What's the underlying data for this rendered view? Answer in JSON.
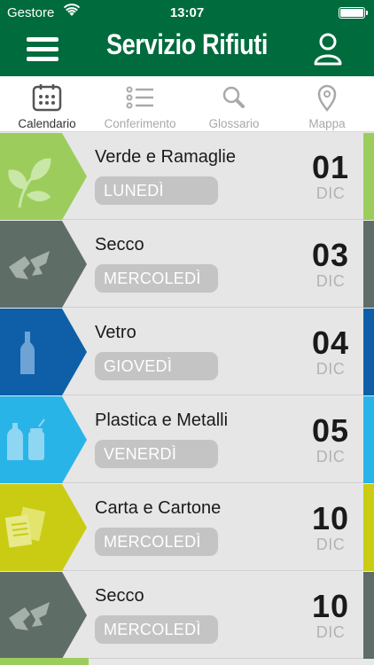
{
  "status_bar": {
    "carrier": "Gestore",
    "time": "13:07"
  },
  "header": {
    "title": "Servizio Rifiuti"
  },
  "tabs": [
    {
      "label": "Calendario",
      "icon": "calendar-icon",
      "active": true
    },
    {
      "label": "Conferimento",
      "icon": "list-icon",
      "active": false
    },
    {
      "label": "Glossario",
      "icon": "search-icon",
      "active": false
    },
    {
      "label": "Mappa",
      "icon": "map-pin-icon",
      "active": false
    }
  ],
  "colors": {
    "brand_green": "#006b3d",
    "verde": "#9ccd5c",
    "secco": "#5f6d67",
    "vetro": "#0f5fa8",
    "plastica": "#29b4e8",
    "carta": "#c9cc12"
  },
  "collections": [
    {
      "name": "Verde e Ramaglie",
      "day": "LUNEDÌ",
      "date": "01",
      "month": "DIC",
      "icon": "leaves-icon",
      "color": "#9ccd5c"
    },
    {
      "name": "Secco",
      "day": "MERCOLEDÌ",
      "date": "03",
      "month": "DIC",
      "icon": "broken-dish-icon",
      "color": "#5f6d67"
    },
    {
      "name": "Vetro",
      "day": "GIOVEDÌ",
      "date": "04",
      "month": "DIC",
      "icon": "bottle-icon",
      "color": "#0f5fa8"
    },
    {
      "name": "Plastica e Metalli",
      "day": "VENERDÌ",
      "date": "05",
      "month": "DIC",
      "icon": "bottle-can-icon",
      "color": "#29b4e8"
    },
    {
      "name": "Carta e Cartone",
      "day": "MERCOLEDÌ",
      "date": "10",
      "month": "DIC",
      "icon": "paper-icon",
      "color": "#c9cc12"
    },
    {
      "name": "Secco",
      "day": "MERCOLEDÌ",
      "date": "10",
      "month": "DIC",
      "icon": "broken-dish-icon",
      "color": "#5f6d67"
    }
  ]
}
